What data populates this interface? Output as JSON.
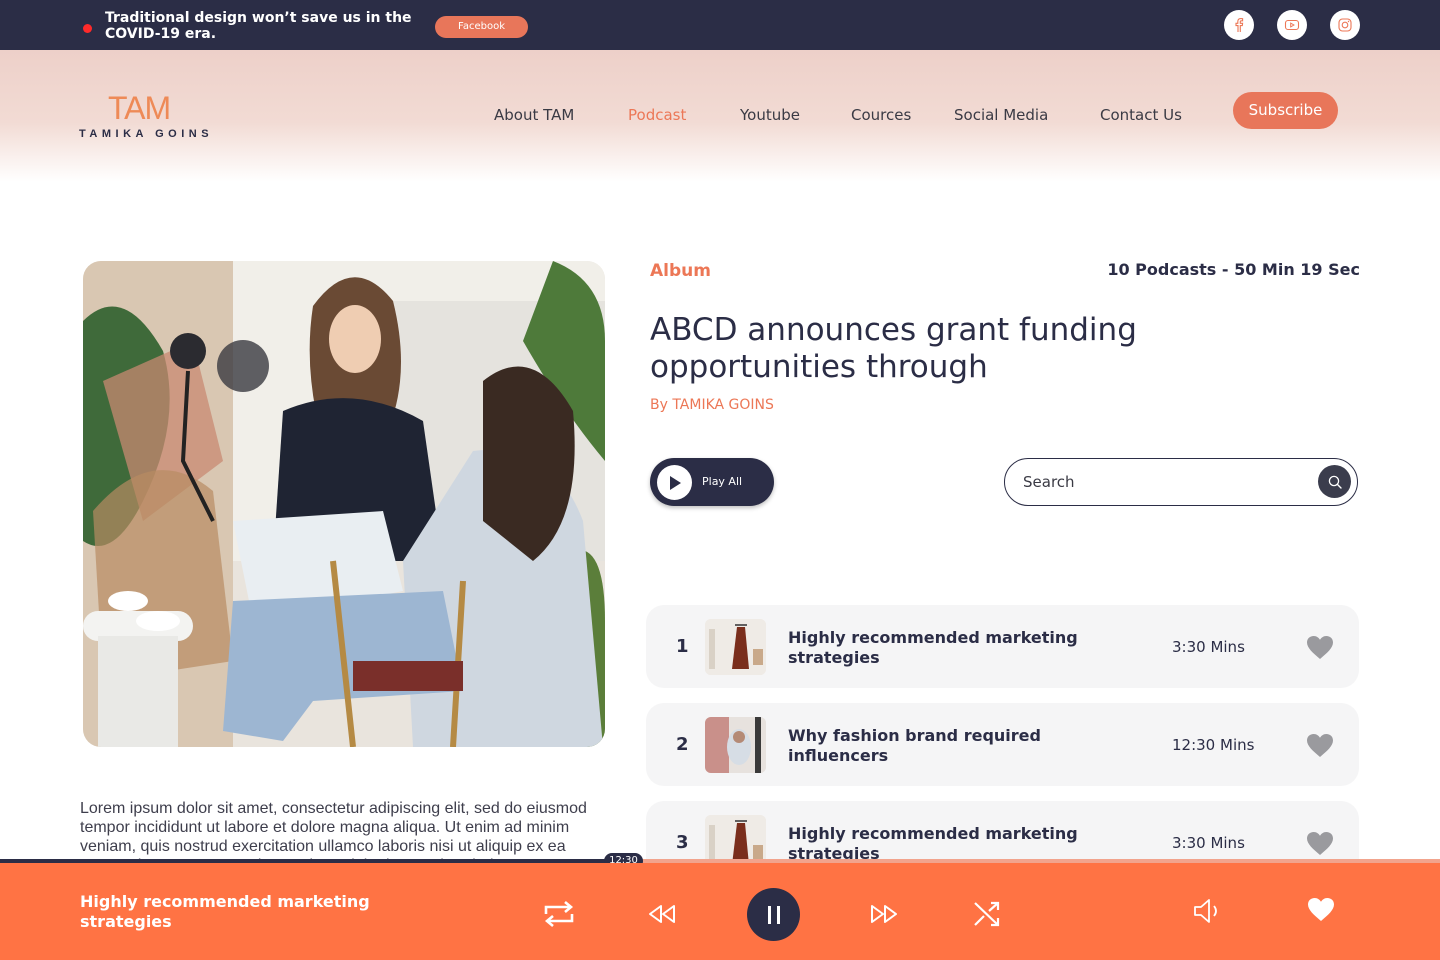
{
  "announcement": {
    "text": "Traditional design won’t save us in the COVID-19 era.",
    "button_label": "Facebook"
  },
  "social_icons": [
    "facebook-icon",
    "youtube-icon",
    "instagram-icon"
  ],
  "brand": {
    "logo_mark": "TAM",
    "logo_name": "TAMIKA GOINS",
    "accent_color": "#ec7756",
    "dark_color": "#2b2d46",
    "player_color": "#ff7344"
  },
  "nav": {
    "items": [
      {
        "label": "About  TAM",
        "active": false
      },
      {
        "label": "Podcast",
        "active": true
      },
      {
        "label": "Youtube",
        "active": false
      },
      {
        "label": "Cources",
        "active": false
      },
      {
        "label": "Social Media",
        "active": false
      },
      {
        "label": "Contact Us",
        "active": false
      }
    ],
    "subscribe_label": "Subscribe"
  },
  "album": {
    "label": "Album",
    "meta": "10 Podcasts - 50 Min 19 Sec",
    "title": "ABCD announces grant funding opportunities through",
    "author": "By TAMIKA GOINS",
    "play_all_label": "Play All"
  },
  "search": {
    "placeholder": "Search",
    "value": ""
  },
  "description": "Lorem ipsum dolor sit amet, consectetur adipiscing elit, sed do eiusmod tempor incididunt ut labore et dolore magna aliqua. Ut enim ad minim veniam, quis nostrud exercitation ullamco laboris nisi ut aliquip ex ea commodo consequat. Duis aute irure dolor in reprehenderit",
  "tracks": [
    {
      "number": "1",
      "title": "Highly recommended marketing strategies",
      "duration": "3:30 Mins"
    },
    {
      "number": "2",
      "title": "Why fashion brand required influencers",
      "duration": "12:30 Mins"
    },
    {
      "number": "3",
      "title": "Highly recommended marketing strategies",
      "duration": "3:30 Mins"
    }
  ],
  "player": {
    "now_playing": "Highly recommended marketing strategies",
    "time": "12:30",
    "progress": 0.43
  }
}
